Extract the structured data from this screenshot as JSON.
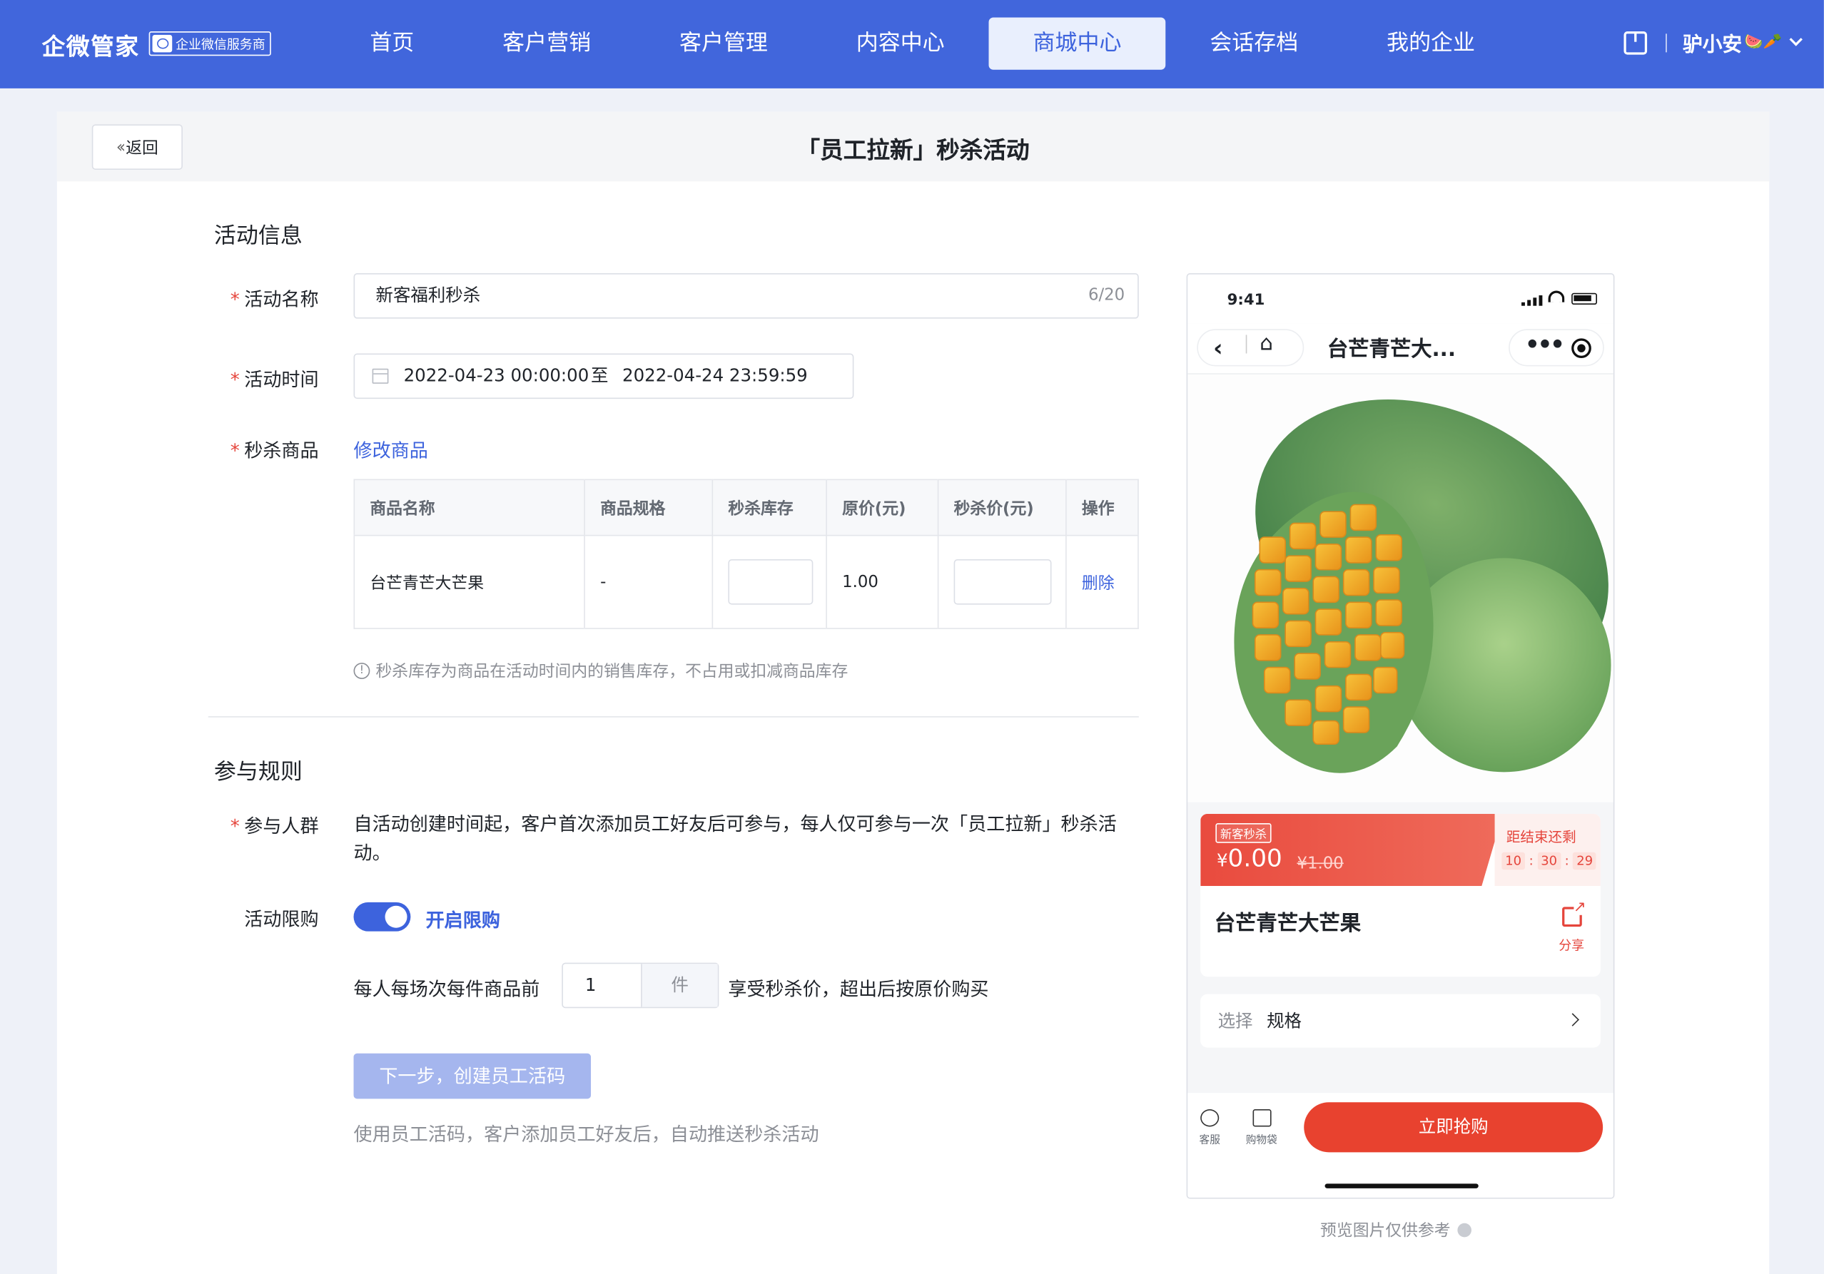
{
  "topbar": {
    "brand": "企微管家",
    "badge": "企业微信服务商",
    "nav": [
      "首页",
      "客户营销",
      "客户管理",
      "内容中心",
      "商城中心",
      "会话存档",
      "我的企业"
    ],
    "active_index": 4,
    "user_name": "驴小安",
    "user_emoji": "🍉🥕"
  },
  "header": {
    "back_label": "返回",
    "title": "「员工拉新」秒杀活动"
  },
  "activity_info": {
    "section_title": "活动信息",
    "name_label": "活动名称",
    "name_value": "新客福利秒杀",
    "name_count": "6/20",
    "time_label": "活动时间",
    "time_start": "2022-04-23 00:00:00",
    "time_to": "至",
    "time_end": "2022-04-24 23:59:59",
    "goods_label": "秒杀商品",
    "edit_goods_link": "修改商品",
    "table": {
      "headers": [
        "商品名称",
        "商品规格",
        "秒杀库存",
        "原价(元)",
        "秒杀价(元)",
        "操作"
      ],
      "rows": [
        {
          "name": "台芒青芒大芒果",
          "spec": "-",
          "stock": "",
          "orig_price": "1.00",
          "sale_price": "",
          "action": "删除"
        }
      ]
    },
    "tip": "秒杀库存为商品在活动时间内的销售库存，不占用或扣减商品库存"
  },
  "rules": {
    "section_title": "参与规则",
    "crowd_label": "参与人群",
    "crowd_text": "自活动创建时间起，客户首次添加员工好友后可参与，每人仅可参与一次「员工拉新」秒杀活动。",
    "limit_label": "活动限购",
    "limit_toggle_label": "开启限购",
    "limit_enabled": true,
    "limit_prefix": "每人每场次每件商品前",
    "limit_value": "1",
    "limit_unit": "件",
    "limit_suffix": "享受秒杀价，超出后按原价购买",
    "next_button": "下一步，创建员工活码",
    "next_desc": "使用员工活码，客户添加员工好友后，自动推送秒杀活动"
  },
  "preview": {
    "time": "9:41",
    "title": "台芒青芒大...",
    "sale_tag": "新客秒杀",
    "currency": "¥",
    "price": "0.00",
    "orig_price": "¥1.00",
    "countdown_label": "距结束还剩",
    "countdown": [
      "10",
      "30",
      "29"
    ],
    "product_name": "台芒青芒大芒果",
    "share_label": "分享",
    "spec_key": "选择",
    "spec_value": "规格",
    "kefu_label": "客服",
    "cart_label": "购物袋",
    "buy_button": "立即抢购",
    "note": "预览图片仅供参考"
  }
}
